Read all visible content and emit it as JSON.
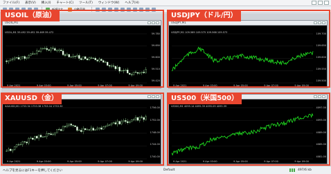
{
  "menu": {
    "items": [
      "ファイル(F)",
      "表示(V)",
      "挿入(I)",
      "チャート(C)",
      "ツール(T)",
      "ウィンドウ(W)",
      "ヘルプ(H)"
    ]
  },
  "toolbar": {
    "new_order_label": "新規注文",
    "auto_trade_label": "自動売買"
  },
  "charts": [
    {
      "label": "USOIL（原油）",
      "window_title": "USOIL,M1",
      "ohlc": "USOIL,M1  59.492 59.492 59.469 59.472",
      "x_ticks": [
        "9 Apr 2021",
        "9 Apr 02:00",
        "9 Apr 03:00",
        "9 Apr 04:00",
        "9 Apr 05:00",
        "9 Apr 06:00",
        "9 Apr 07:00",
        "9 Apr 08:00",
        "9 Apr 09:00"
      ],
      "y_ticks": [
        "59.780",
        "59.690",
        "59.600",
        "59.510",
        "59.420"
      ],
      "style": "candles",
      "color": "#ffffff"
    },
    {
      "label": "USDJPY（ドル/円）",
      "window_title": "USDJPY,M1",
      "ohlc": "USDJPY,M1  109.569 109.575 109.568 109.573",
      "x_ticks": [
        "9 Apr 2021",
        "9 Apr 02:00",
        "9 Apr 03:00",
        "9 Apr 04:00",
        "9 Apr 05:00",
        "9 Apr 06:00",
        "9 Apr 07:00",
        "9 Apr 08:00",
        "9 Apr 09:00"
      ],
      "y_ticks": [
        "109.700",
        "109.650",
        "109.600",
        "109.550",
        "109.500"
      ],
      "style": "line",
      "color": "#22ee22"
    },
    {
      "label": "XAUUSD（金）",
      "window_title": "XAUUSD,M1",
      "ohlc": "XAUUSD,M1  1753.34 1753.38 1753.04 1753.30",
      "x_ticks": [
        "9 Apr 2021",
        "9 Apr 02:00",
        "9 Apr 03:00",
        "9 Apr 04:00",
        "9 Apr 05:00",
        "9 Apr 06:00",
        "9 Apr 07:00",
        "9 Apr 08:00",
        "9 Apr 09:00"
      ],
      "y_ticks": [
        "1756.00",
        "1752.00",
        "1748.00",
        "1744.00",
        "1740.00"
      ],
      "style": "candles",
      "color": "#ffffff"
    },
    {
      "label": "US500（米国500）",
      "window_title": "US500,M1",
      "ohlc": "US500,M1  4095.14 4095.39 4095.09 4095.39",
      "x_ticks": [
        "9 Apr 2021",
        "9 Apr 02:00",
        "9 Apr 03:00",
        "9 Apr 04:00",
        "9 Apr 05:00",
        "9 Apr 06:00",
        "9 Apr 07:00",
        "9 Apr 08:00",
        "9 Apr 09:00"
      ],
      "y_ticks": [
        "4097.00",
        "4093.00",
        "4089.00",
        "4085.00",
        "4081.00"
      ],
      "style": "line",
      "color": "#22ee22"
    }
  ],
  "status": {
    "help_text": "ヘルプを見るにはF1キーを押してください",
    "profile": "Default",
    "traffic": "497/6 kb"
  },
  "colors": {
    "accent": "#e8462f",
    "chart_bg": "#000000",
    "line": "#22ee22"
  }
}
